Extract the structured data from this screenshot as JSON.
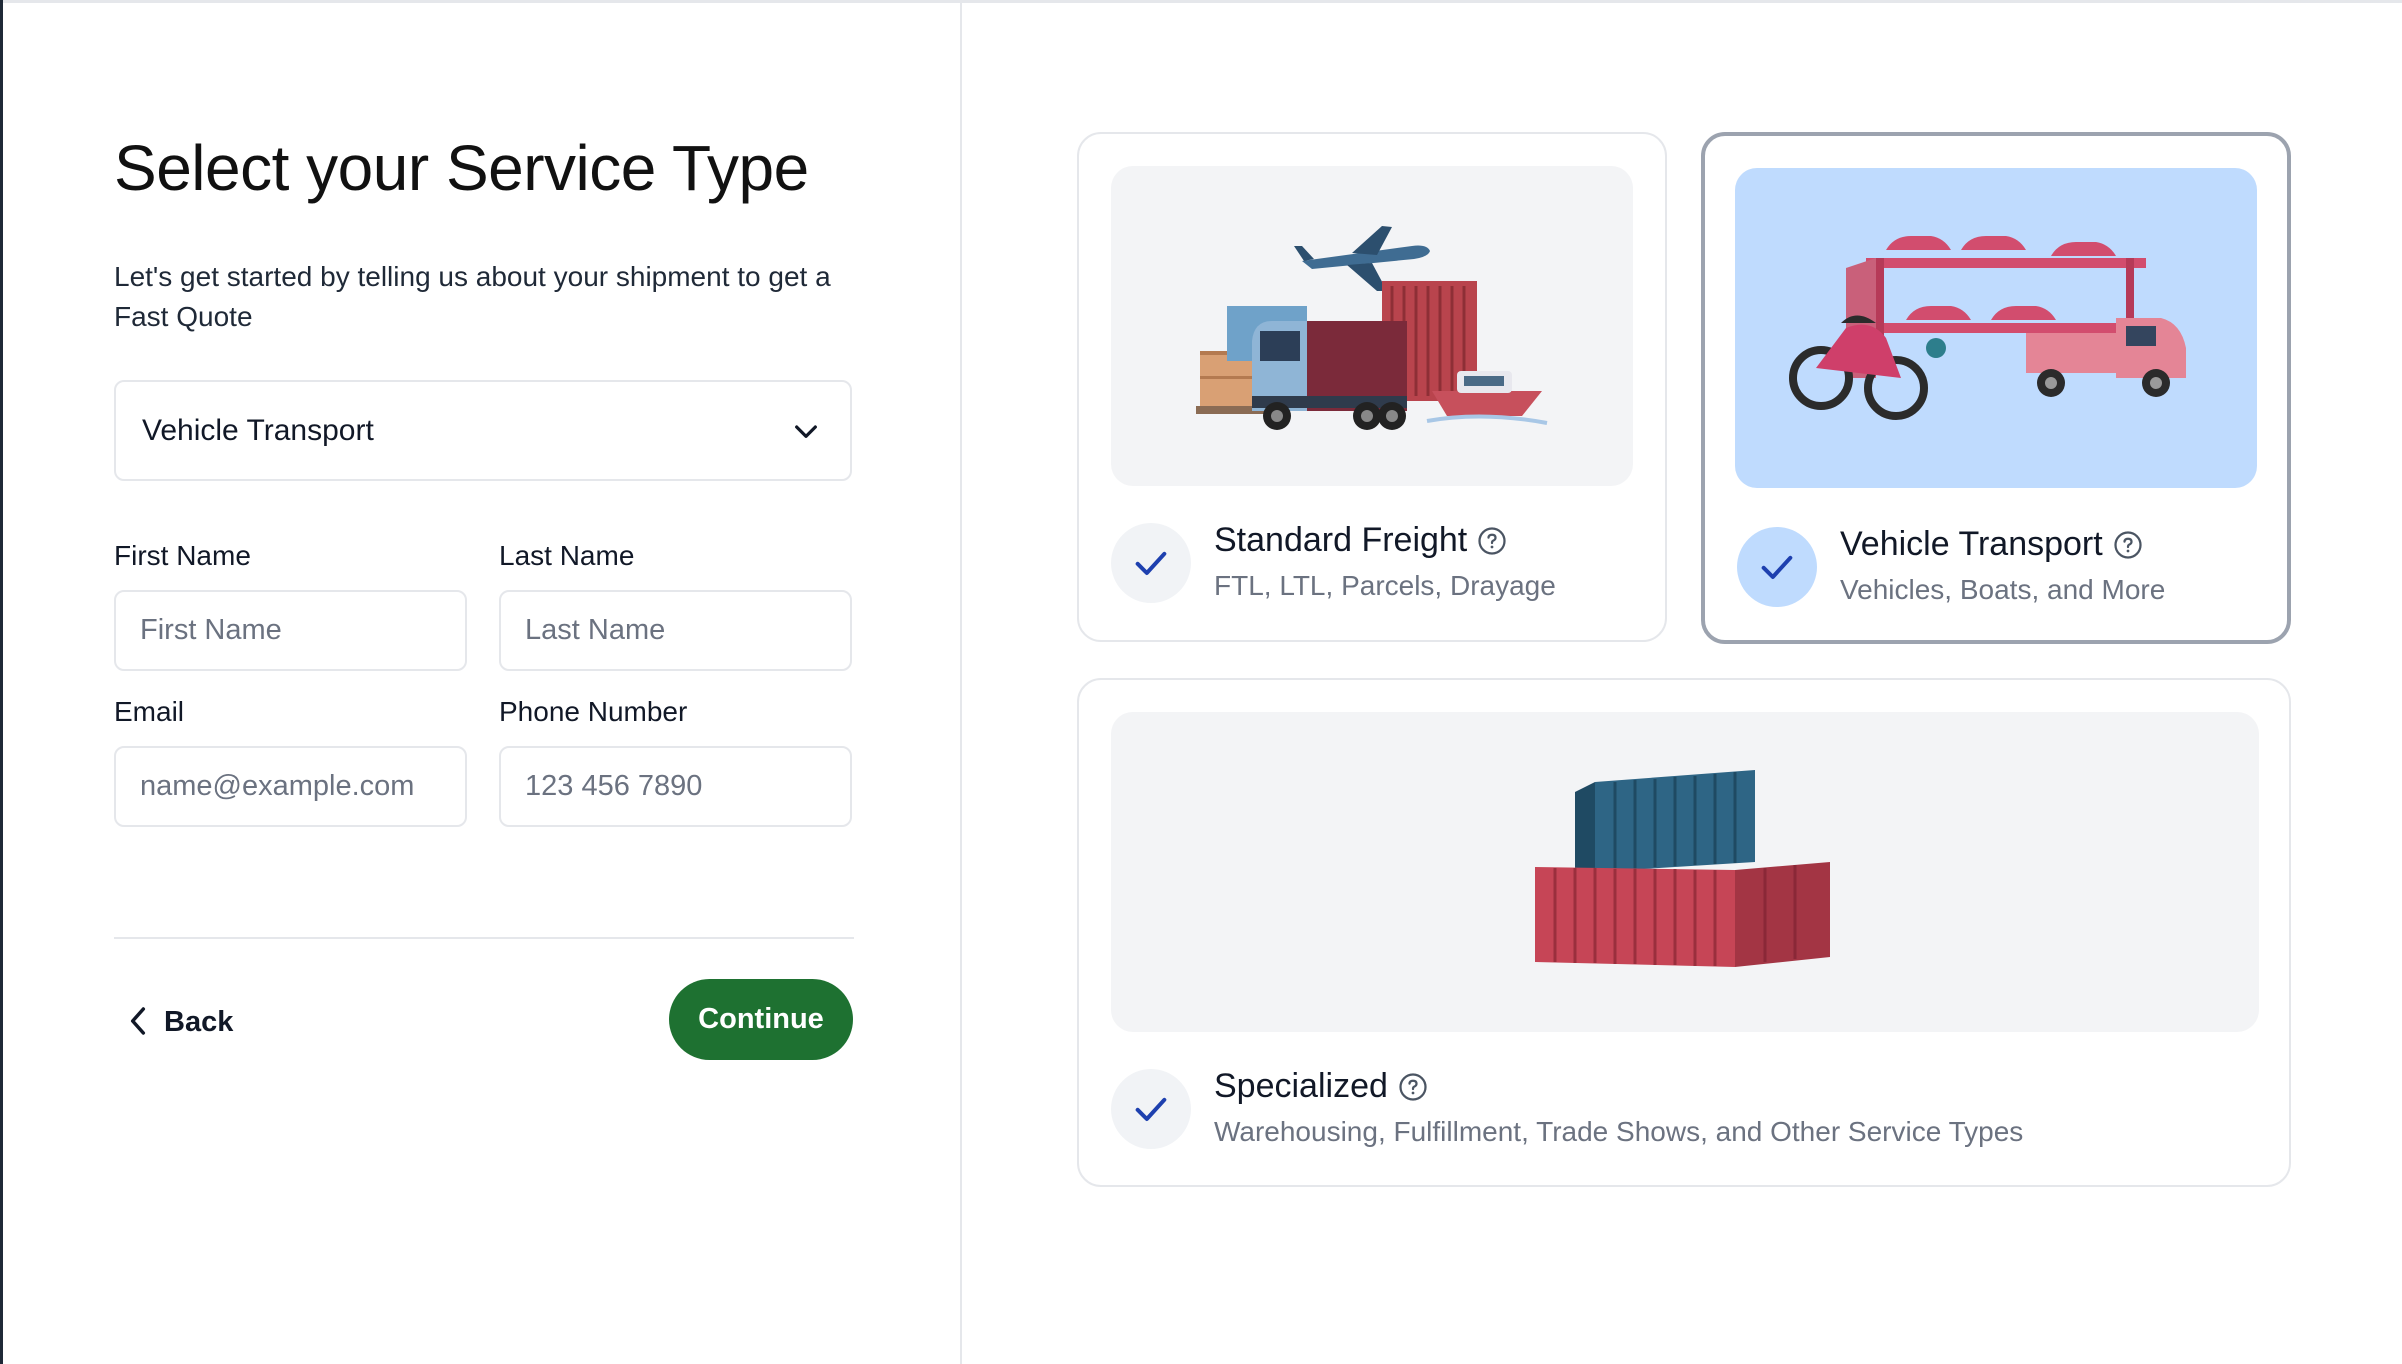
{
  "form": {
    "title": "Select your Service Type",
    "subtitle": "Let's get started by telling us about your shipment to get a Fast Quote",
    "service_select": {
      "value": "Vehicle Transport"
    },
    "first_name": {
      "label": "First Name",
      "placeholder": "First Name"
    },
    "last_name": {
      "label": "Last Name",
      "placeholder": "Last Name"
    },
    "email": {
      "label": "Email",
      "placeholder": "name@example.com"
    },
    "phone": {
      "label": "Phone Number",
      "placeholder": "123 456 7890"
    },
    "back_label": "Back",
    "continue_label": "Continue"
  },
  "service_cards": [
    {
      "title": "Standard Freight",
      "subtitle": "FTL, LTL, Parcels, Drayage",
      "selected": false,
      "icon": "freight-illustration"
    },
    {
      "title": "Vehicle Transport",
      "subtitle": "Vehicles, Boats, and More",
      "selected": true,
      "icon": "vehicle-transport-illustration"
    },
    {
      "title": "Specialized",
      "subtitle": "Warehousing, Fulfillment, Trade Shows, and Other Service Types",
      "selected": false,
      "icon": "containers-illustration"
    }
  ],
  "colors": {
    "accent_green": "#1e7131",
    "check_blue": "#1e40af",
    "selected_bg": "#bfdbfe",
    "card_image_bg": "#f3f4f6"
  }
}
